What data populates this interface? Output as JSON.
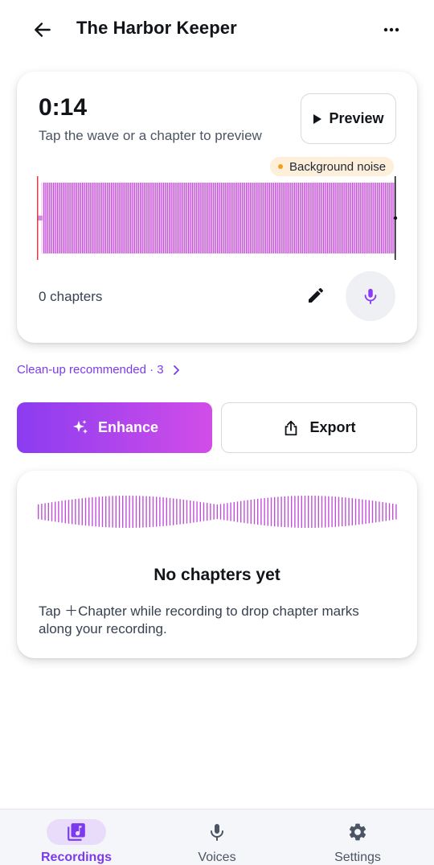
{
  "header": {
    "title": "The Harbor Keeper",
    "back_icon": "arrow-left-icon",
    "more_icon": "more-horizontal-icon"
  },
  "player": {
    "time": "0:14",
    "hint": "Tap the wave or a chapter to preview",
    "preview_label": "Preview",
    "noise_badge": "Background noise",
    "chapters_count": "0 chapters",
    "playhead_progress": 0.0
  },
  "cleanup": {
    "label": "Clean-up recommended · 3"
  },
  "actions": {
    "enhance_label": "Enhance",
    "export_label": "Export"
  },
  "empty_state": {
    "title": "No chapters yet",
    "description": "Tap ＋Chapter while recording to drop chapter marks along your recording."
  },
  "nav": {
    "items": [
      {
        "label": "Recordings",
        "icon": "music-library-icon",
        "active": true
      },
      {
        "label": "Voices",
        "icon": "microphone-icon",
        "active": false
      },
      {
        "label": "Settings",
        "icon": "gear-icon",
        "active": false
      }
    ]
  },
  "colors": {
    "accent": "#7c3aed",
    "wave": "#c04fd8",
    "enhance_gradient_start": "#8b3cf0",
    "enhance_gradient_end": "#d24de8",
    "badge_bg": "#fdefd9",
    "badge_dot": "#f0a020"
  }
}
